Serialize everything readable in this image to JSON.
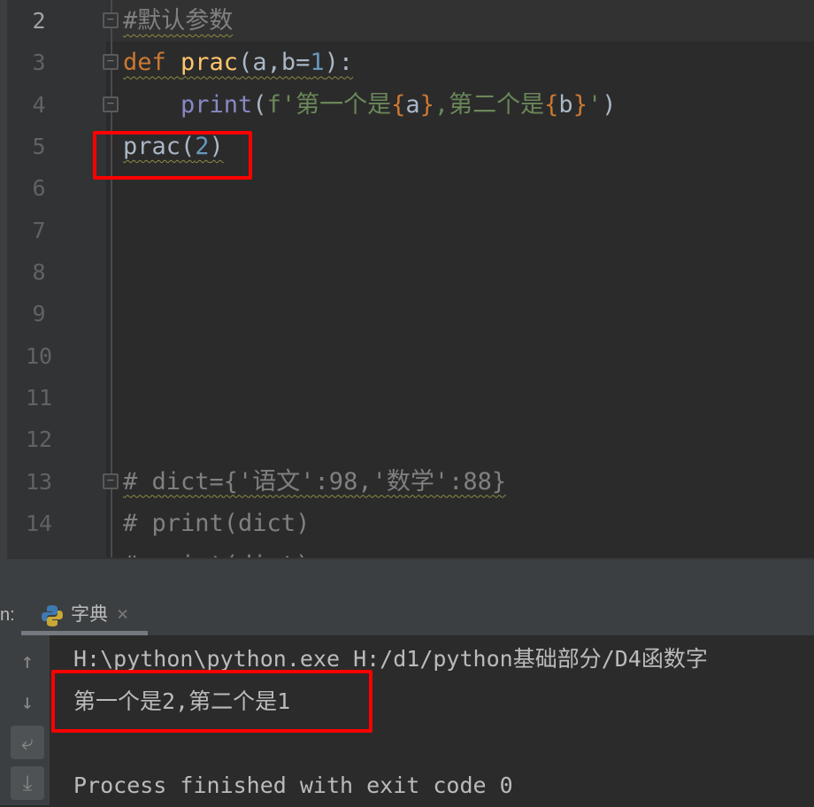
{
  "editor": {
    "active_line": 2,
    "lines": [
      {
        "num": "2",
        "fold": true,
        "wavy": true,
        "tokens": [
          [
            "#默认参数",
            "comment"
          ]
        ]
      },
      {
        "num": "3",
        "fold": true,
        "wavy": true,
        "tokens": [
          [
            "def ",
            "kw"
          ],
          [
            "prac",
            "fn"
          ],
          [
            "(a,b=",
            "plain"
          ],
          [
            "1",
            "num"
          ],
          [
            "):",
            "plain"
          ]
        ]
      },
      {
        "num": "4",
        "fold": true,
        "wavy": false,
        "tokens": [
          [
            "    ",
            "plain"
          ],
          [
            "print",
            "builtin"
          ],
          [
            "(",
            "plain"
          ],
          [
            "f'第一个是",
            "str"
          ],
          [
            "{",
            "brace"
          ],
          [
            "a",
            "plain"
          ],
          [
            "}",
            "brace"
          ],
          [
            ",第二个是",
            "str"
          ],
          [
            "{",
            "brace"
          ],
          [
            "b",
            "plain"
          ],
          [
            "}",
            "brace"
          ],
          [
            "'",
            "str"
          ],
          [
            ")",
            "plain"
          ]
        ]
      },
      {
        "num": "5",
        "fold": false,
        "wavy": true,
        "tokens": [
          [
            "prac(",
            "plain"
          ],
          [
            "2",
            "num"
          ],
          [
            ")",
            "plain"
          ]
        ]
      },
      {
        "num": "6",
        "fold": false,
        "wavy": false,
        "tokens": []
      },
      {
        "num": "7",
        "fold": false,
        "wavy": false,
        "tokens": []
      },
      {
        "num": "8",
        "fold": false,
        "wavy": false,
        "tokens": []
      },
      {
        "num": "9",
        "fold": false,
        "wavy": false,
        "tokens": []
      },
      {
        "num": "10",
        "fold": false,
        "wavy": false,
        "tokens": []
      },
      {
        "num": "11",
        "fold": false,
        "wavy": false,
        "tokens": []
      },
      {
        "num": "12",
        "fold": false,
        "wavy": false,
        "tokens": []
      },
      {
        "num": "13",
        "fold": true,
        "wavy": true,
        "tokens": [
          [
            "# dict={'语文':98,'数学':88}",
            "comment"
          ]
        ]
      },
      {
        "num": "14",
        "fold": false,
        "wavy": false,
        "tokens": [
          [
            "# print(dict)",
            "comment"
          ]
        ]
      },
      {
        "num": "",
        "fold": false,
        "wavy": false,
        "tokens": [
          [
            "# print(dict)",
            "comment"
          ]
        ]
      }
    ]
  },
  "run_panel": {
    "label": "n:",
    "tab_label": "字典",
    "tab_icon": "python-icon",
    "close_glyph": "×"
  },
  "console": {
    "lines": [
      "H:\\python\\python.exe H:/d1/python基础部分/D4函数字",
      "第一个是2,第二个是1",
      "",
      "Process finished with exit code 0"
    ]
  },
  "colors": {
    "highlight_box": "#ff0000",
    "keyword": "#cc7832",
    "function": "#ffc66d",
    "number": "#6897bb",
    "string": "#6a8759",
    "comment": "#808080"
  }
}
